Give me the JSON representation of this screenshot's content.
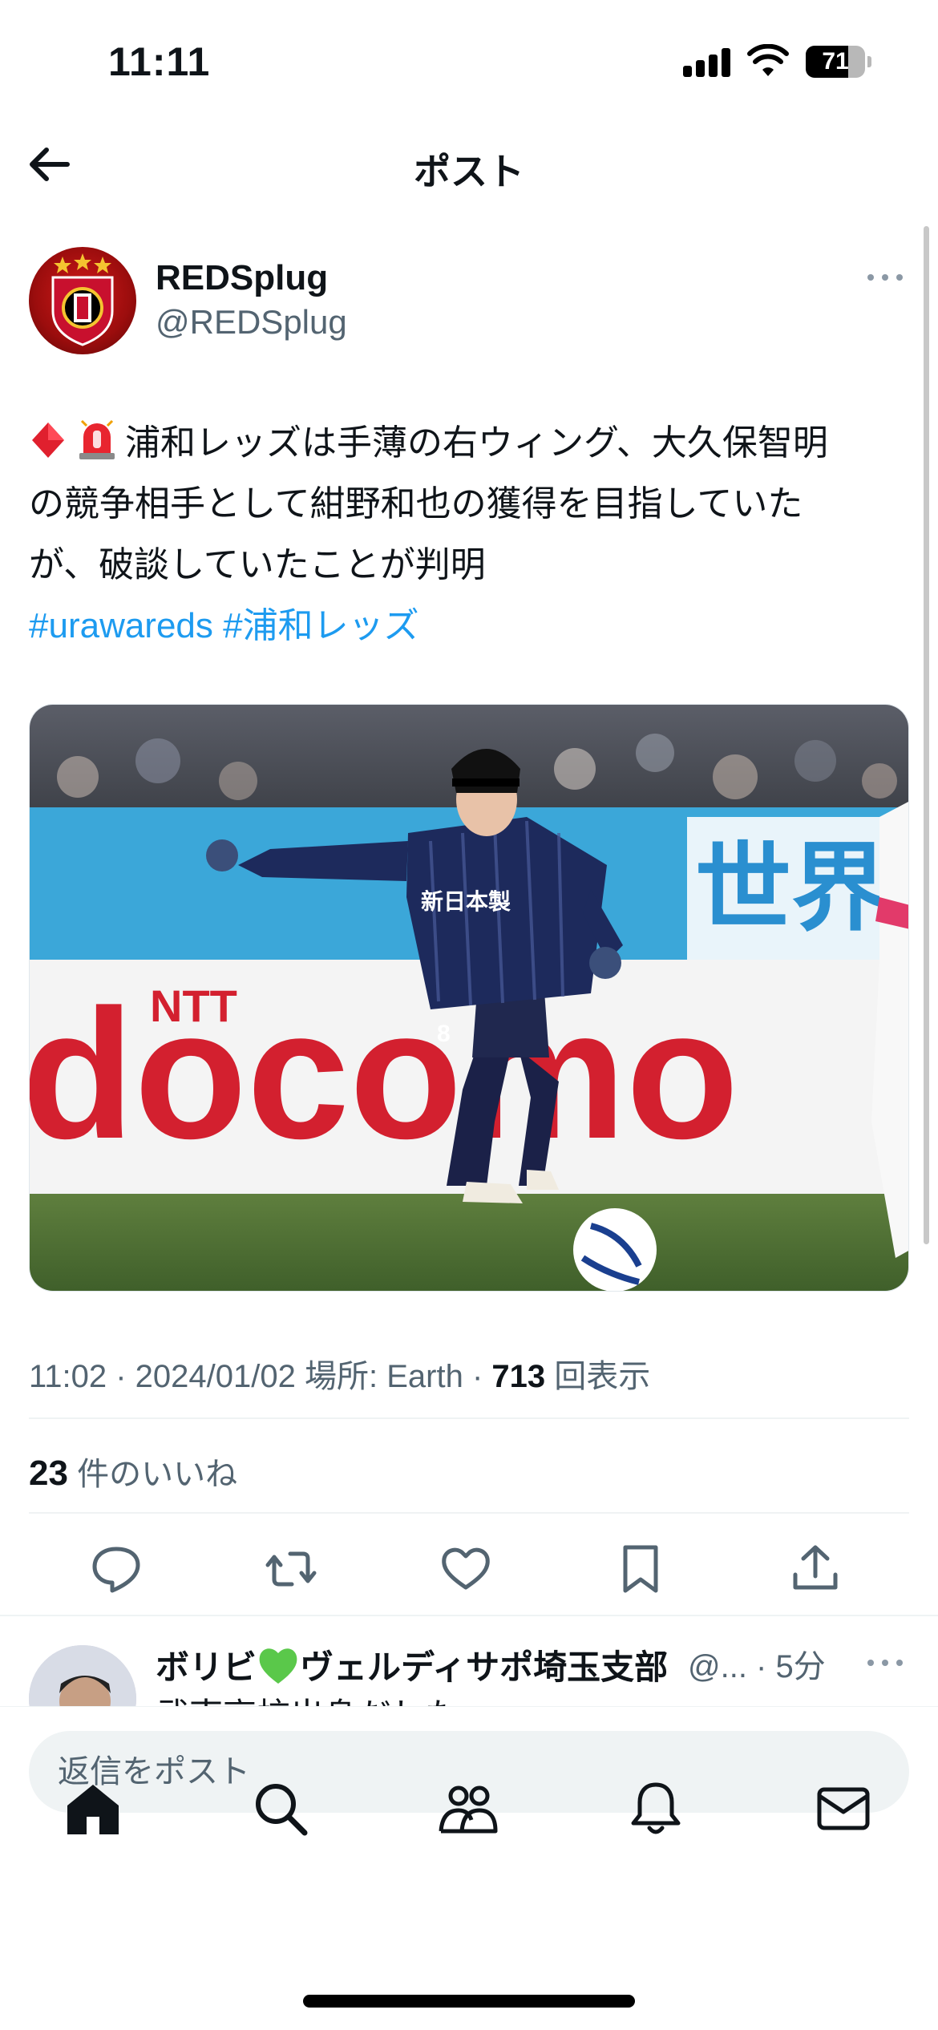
{
  "status_bar": {
    "time": "11:11",
    "battery_percent": "71",
    "battery_level": 0.71
  },
  "header": {
    "title": "ポスト"
  },
  "post": {
    "author_name": "REDSplug",
    "author_handle": "@REDSplug",
    "text_line1": "浦和レッズは手薄の右ウィング、大久保智明",
    "text_line2": "の競争相手として紺野和也の獲得を目指していた",
    "text_line3": "が、破談していたことが判明",
    "hashtag1": "#urawareds",
    "hashtag2": "#浦和レッズ",
    "timestamp": "11:02 · 2024/01/02",
    "location": "場所: Earth",
    "separator": "·",
    "views_count": "713",
    "views_label": "回表示",
    "likes_count": "23",
    "likes_label": "件のいいね"
  },
  "media_text": {
    "sponsor_small": "NTT",
    "sponsor": "docomo",
    "banner": "世界",
    "shirt": "新日本製",
    "number": "8"
  },
  "reply": {
    "name_part1": "ボリビ",
    "name_part2": "ヴェルディサポ埼玉支部",
    "handle_time": "@... · 5分",
    "text": "武南高校出身だした"
  },
  "compose": {
    "placeholder": "返信をポスト"
  },
  "icons": {
    "back": "arrow-left-icon",
    "more": "more-dots-icon",
    "reply": "comment-icon",
    "repost": "repost-icon",
    "like": "heart-icon",
    "bookmark": "bookmark-icon",
    "share": "share-icon",
    "home": "home-icon",
    "search": "search-icon",
    "communities": "people-icon",
    "notifications": "bell-icon",
    "messages": "mail-icon"
  },
  "colors": {
    "link": "#1d9bf0",
    "secondary_text": "#536471",
    "divider": "#eff3f4"
  }
}
